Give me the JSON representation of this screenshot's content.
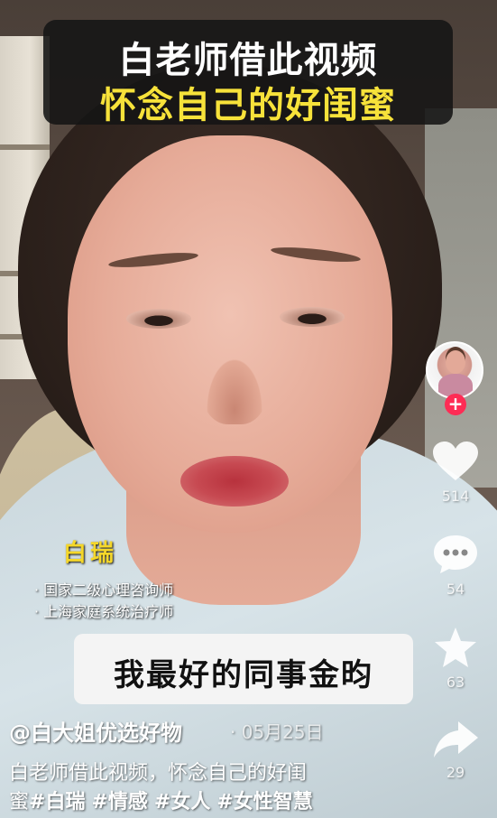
{
  "video": {
    "title_line1": "白老师借此视频",
    "title_line2": "怀念自己的好闺蜜",
    "speaker_name": "白瑞",
    "credentials": [
      "· 国家二级心理咨询师",
      "· 上海家庭系统治疗师"
    ],
    "subtitle": "我最好的同事金昀"
  },
  "rail": {
    "likes": "514",
    "comments": "54",
    "favorites": "63",
    "shares": "29"
  },
  "post": {
    "author": "@白大姐优选好物",
    "date": "· 05月25日",
    "desc_line1": "白老师借此视频，怀念自己的好闺",
    "desc_line2_prefix": "蜜",
    "hashtags": [
      "#白瑞",
      "#情感",
      "#女人",
      "#女性智慧"
    ]
  },
  "colors": {
    "title_white": "#ffffff",
    "title_yellow": "#f7e23a",
    "name_yellow": "#f5d72a",
    "follow_red": "#fe2c55"
  },
  "icons": [
    "heart-icon",
    "comment-icon",
    "star-icon",
    "share-icon",
    "plus-icon"
  ]
}
